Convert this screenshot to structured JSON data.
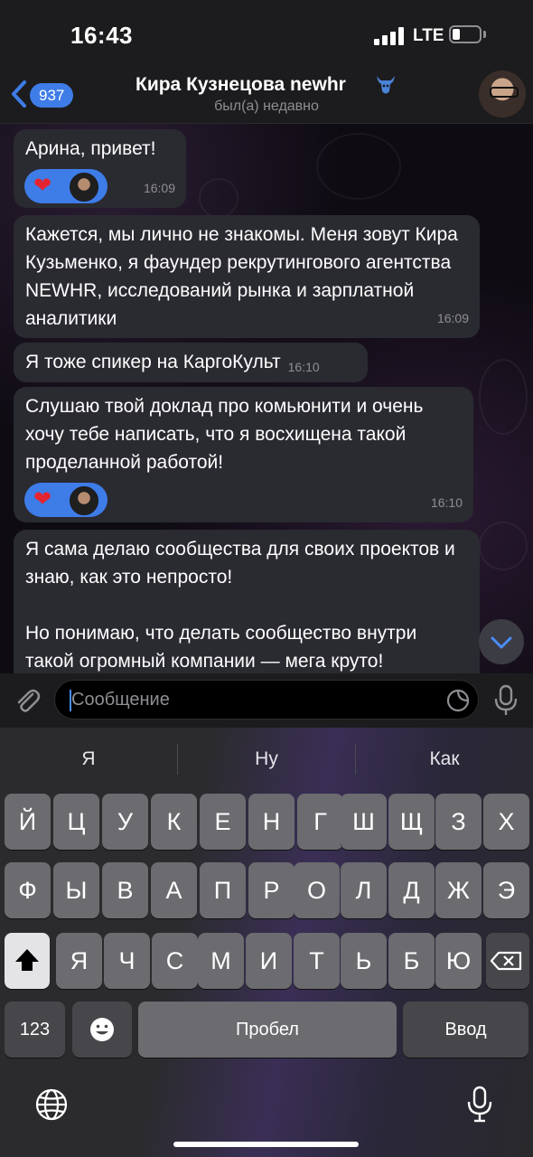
{
  "status": {
    "time": "16:43",
    "network": "LTE"
  },
  "header": {
    "back_badge": "937",
    "title": "Кира Кузнецова newhr",
    "subtitle": "был(а) недавно"
  },
  "messages": [
    {
      "text": "Арина, привет!",
      "time": "16:09",
      "reaction": "heart"
    },
    {
      "text": "Кажется, мы лично не знакомы. Меня зовут Кира Кузьменко, я фаундер рекрутингового агентства NEWHR, исследований рынка и зарплатной аналитики",
      "time": "16:09"
    },
    {
      "text": "Я тоже спикер на КаргоКульт",
      "time": "16:10"
    },
    {
      "text": "Слушаю твой доклад про комьюнити и очень хочу тебе написать, что я восхищена такой проделанной работой!",
      "time": "16:10",
      "reaction": "heart"
    },
    {
      "text": "Я сама делаю сообщества для своих проектов и знаю, как это непросто!",
      "text2": "Но понимаю, что делать сообщество внутри такой огромный компании — мега круто!"
    }
  ],
  "input": {
    "placeholder": "Сообщение"
  },
  "keyboard": {
    "suggestions": [
      "Я",
      "Ну",
      "Как"
    ],
    "row1": [
      "Й",
      "Ц",
      "У",
      "К",
      "Е",
      "Н",
      "Г",
      "Ш",
      "Щ",
      "З",
      "Х"
    ],
    "row2": [
      "Ф",
      "Ы",
      "В",
      "А",
      "П",
      "Р",
      "О",
      "Л",
      "Д",
      "Ж",
      "Э"
    ],
    "row3": [
      "Я",
      "Ч",
      "С",
      "М",
      "И",
      "Т",
      "Ь",
      "Б",
      "Ю"
    ],
    "numbers_key": "123",
    "space_key": "Пробел",
    "return_key": "Ввод"
  },
  "colors": {
    "accent": "#3e7ce7",
    "bubble": "#2a2a31",
    "heart": "#e5242f"
  }
}
